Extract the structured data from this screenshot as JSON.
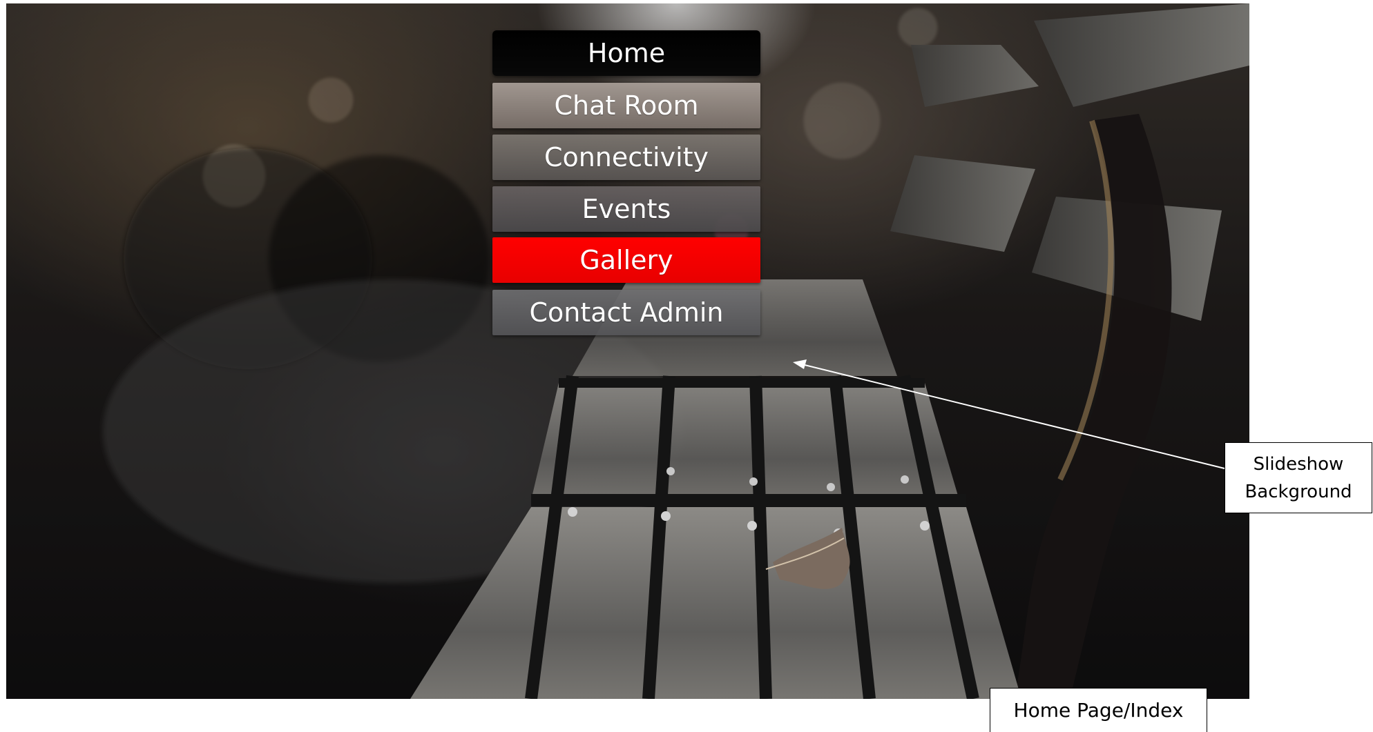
{
  "navigation": {
    "items": [
      {
        "label": "Home",
        "state": "default"
      },
      {
        "label": "Chat Room",
        "state": "default"
      },
      {
        "label": "Connectivity",
        "state": "default"
      },
      {
        "label": "Events",
        "state": "default"
      },
      {
        "label": "Gallery",
        "state": "active"
      },
      {
        "label": "Contact Admin",
        "state": "default"
      }
    ]
  },
  "annotations": {
    "slideshow_label_line1": "Slideshow",
    "slideshow_label_line2": "Background",
    "page_label": "Home Page/Index"
  },
  "colors": {
    "active_nav": "#ff0000",
    "home_nav": "#000000",
    "annotation_border": "#000000",
    "annotation_background": "#ffffff"
  }
}
